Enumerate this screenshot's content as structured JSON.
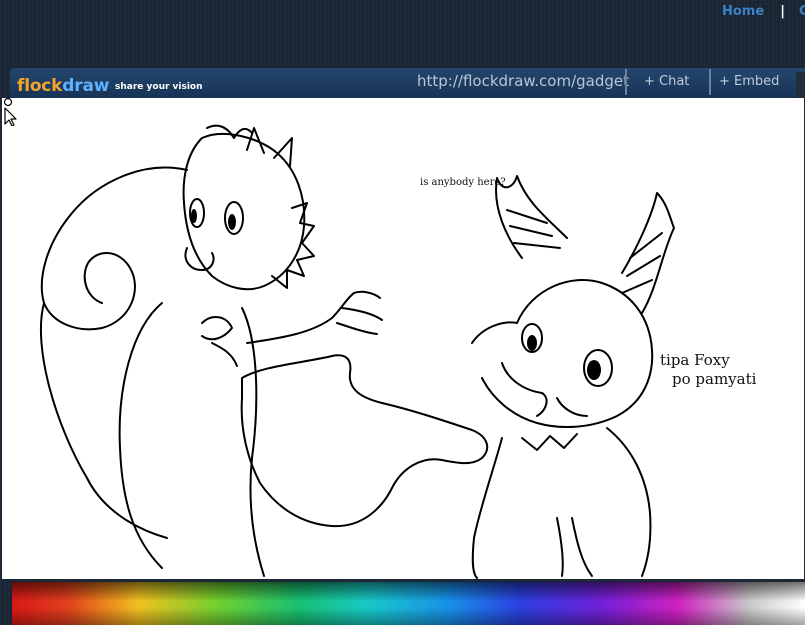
{
  "nav": {
    "home": "Home",
    "separator": "|",
    "gallery_partial": "Ga"
  },
  "header": {
    "logo_part1": "flock",
    "logo_part2": "draw",
    "tagline": "share your vision",
    "url": "http://flockdraw.com/gadget",
    "chat_button": "+ Chat",
    "embed_button": "+ Embed"
  },
  "canvas": {
    "speech_text": "is anybody here?",
    "caption_line1": "tipa Foxy",
    "caption_line2": "po pamyati"
  },
  "icons": {
    "cursor": "arrow-cursor-icon"
  },
  "palette": {
    "type": "color-picker-gradient"
  }
}
